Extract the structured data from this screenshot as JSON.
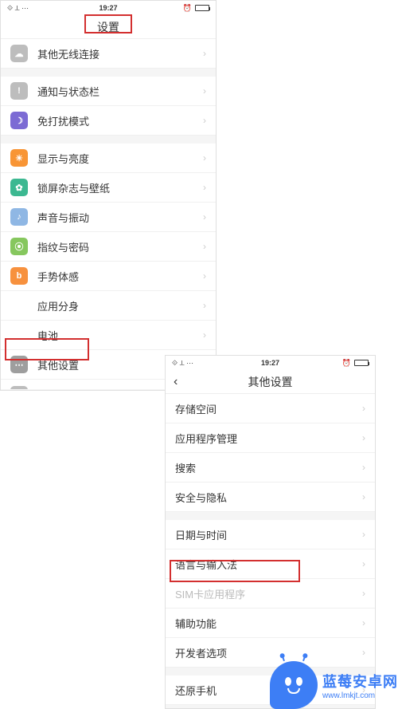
{
  "statusbar": {
    "time": "19:27",
    "signal": "⟐ ⟂ ···",
    "alarm": "⏰"
  },
  "screen1": {
    "title": "设置",
    "groups": [
      [
        {
          "icon": "ic-gray",
          "glyph": "☁",
          "label": "其他无线连接"
        }
      ],
      [
        {
          "icon": "ic-gray",
          "glyph": "!",
          "label": "通知与状态栏"
        },
        {
          "icon": "ic-purple",
          "glyph": "☽",
          "label": "免打扰模式"
        }
      ],
      [
        {
          "icon": "ic-orange",
          "glyph": "☀",
          "label": "显示与亮度"
        },
        {
          "icon": "ic-teal",
          "glyph": "✿",
          "label": "锁屏杂志与壁纸"
        },
        {
          "icon": "ic-lblue",
          "glyph": "♪",
          "label": "声音与振动"
        },
        {
          "icon": "ic-green",
          "glyph": "⦿",
          "label": "指纹与密码"
        },
        {
          "icon": "ic-borange",
          "glyph": "b",
          "label": "手势体感"
        },
        {
          "icon": "spacer",
          "glyph": "",
          "label": "应用分身"
        },
        {
          "icon": "spacer",
          "glyph": "",
          "label": "电池"
        },
        {
          "icon": "ic-dgray",
          "glyph": "⋯",
          "label": "其他设置"
        }
      ]
    ],
    "cutoff": {
      "icon": "ic-gray",
      "glyph": "✚",
      "label": ""
    }
  },
  "screen2": {
    "title": "其他设置",
    "groups": [
      [
        {
          "label": "存储空间"
        },
        {
          "label": "应用程序管理"
        },
        {
          "label": "搜索"
        },
        {
          "label": "安全与隐私"
        }
      ],
      [
        {
          "label": "日期与时间"
        },
        {
          "label": "语言与输入法"
        },
        {
          "label": "SIM卡应用程序",
          "disabled": true
        },
        {
          "label": "辅助功能"
        },
        {
          "label": "开发者选项"
        }
      ],
      [
        {
          "label": "还原手机"
        }
      ]
    ]
  },
  "watermark": {
    "main": "蓝莓安卓网",
    "sub": "www.lmkjt.com"
  }
}
